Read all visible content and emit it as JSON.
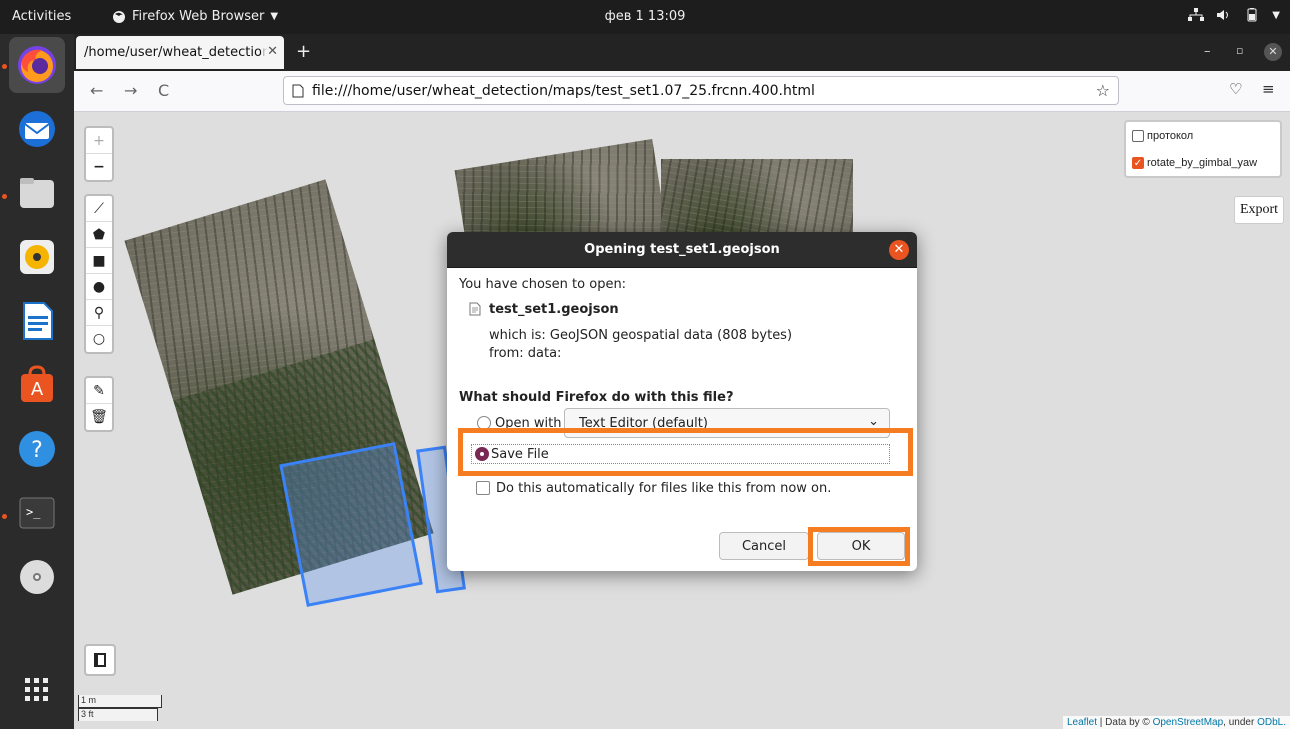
{
  "topbar": {
    "activities": "Activities",
    "app_name": "Firefox Web Browser",
    "clock": "фев 1  13:09"
  },
  "browser": {
    "tab_title": "/home/user/wheat_detection",
    "url": "file:///home/user/wheat_detection/maps/test_set1.07_25.frcnn.400.html"
  },
  "map": {
    "layers": [
      {
        "label": "протокол",
        "checked": false
      },
      {
        "label": "rotate_by_gimbal_yaw",
        "checked": true
      }
    ],
    "export_label": "Export",
    "scale_metric": "1 m",
    "scale_imperial": "3 ft",
    "attribution": {
      "leaflet": "Leaflet",
      "mid": " | Data by © ",
      "osm": "OpenStreetMap",
      "under": ", under ",
      "odbl": "ODbL."
    }
  },
  "dialog": {
    "title": "Opening test_set1.geojson",
    "intro": "You have chosen to open:",
    "filename": "test_set1.geojson",
    "which_is": "which is: GeoJSON geospatial data (808 bytes)",
    "from": "from: data:",
    "question": "What should Firefox do with this file?",
    "open_with_label": "Open with",
    "open_with_app": "Text Editor (default)",
    "save_file_label": "Save File",
    "auto_label": "Do this automatically for files like this from now on.",
    "cancel_label": "Cancel",
    "ok_label": "OK",
    "selected_option": "save_file"
  },
  "colors": {
    "highlight": "#f57c20",
    "ubuntu_orange": "#e95420",
    "radio_selected": "#772953",
    "polygon": "#3b82f6"
  },
  "icons": {
    "dock": [
      "firefox-icon",
      "thunderbird-icon",
      "files-icon",
      "rhythmbox-icon",
      "libreoffice-writer-icon",
      "software-center-icon",
      "help-icon",
      "terminal-icon",
      "dvd-icon",
      "app-grid-icon"
    ]
  }
}
